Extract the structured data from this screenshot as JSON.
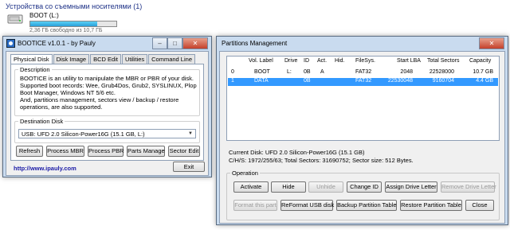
{
  "explorer": {
    "section_title": "Устройства со съемными носителями (1)",
    "drive": {
      "name": "BOOT (L:)",
      "free_text": "2,36 ГБ свободно из 10,7 ГБ",
      "used_fraction": 0.78
    }
  },
  "bootice": {
    "title": "BOOTICE v1.0.1 - by Pauly",
    "title_buttons": {
      "minimize": "–",
      "maximize": "□",
      "close": "✕"
    },
    "tabs": [
      "Physical Disk",
      "Disk Image",
      "BCD Edit",
      "Utilities",
      "Command Line"
    ],
    "description": {
      "label": "Description",
      "lines": [
        "BOOTICE is an utility to manipulate the MBR or PBR of your disk.",
        "Supported boot records: Wee, Grub4Dos, Grub2, SYSLINUX, Plop",
        "Boot Manager, Windows NT 5/6 etc.",
        "And, partitions management, sectors view / backup / restore",
        "operations, are also supported."
      ]
    },
    "destination": {
      "label": "Destination Disk",
      "selected": "USB: UFD 2.0 Silicon-Power16G (15.1 GB, L:)"
    },
    "buttons": {
      "refresh": "Refresh",
      "process_mbr": "Process MBR",
      "process_pbr": "Process PBR",
      "parts_manage": "Parts Manage",
      "sector_edit": "Sector Edit",
      "exit": "Exit"
    },
    "link": "http://www.ipauly.com"
  },
  "partitions": {
    "title": "Partitions Management",
    "columns": [
      "",
      "Vol. Label",
      "Drive",
      "ID",
      "Act.",
      "Hid.",
      "FileSys.",
      "Start LBA",
      "Total Sectors",
      "Capacity"
    ],
    "rows": [
      [
        "0",
        "BOOT",
        "L:",
        "0B",
        "A",
        "",
        "FAT32",
        "2048",
        "22528000",
        "10.7 GB"
      ],
      [
        "1",
        "DATA",
        "",
        "0B",
        "",
        "",
        "FAT32",
        "22530048",
        "9160704",
        "4.4 GB"
      ]
    ],
    "selected_row": 1,
    "current_disk": "Current Disk:  UFD 2.0 Silicon-Power16G (15.1 GB)",
    "chs_info": "C/H/S: 1972/255/63; Total Sectors: 31690752; Sector size: 512 Bytes.",
    "operation_label": "Operation",
    "buttons": {
      "activate": "Activate",
      "hide": "Hide",
      "unhide": "Unhide",
      "change_id": "Change ID",
      "assign_drive_letter": "Assign Drive Letter",
      "remove_drive_letter": "Remove Drive Letter",
      "format_this_part": "Format this part",
      "reformat_usb_disk": "ReFormat USB disk",
      "backup_partition_table": "Backup Partition Table",
      "restore_partition_table": "Restore Partition Table",
      "close": "Close"
    }
  }
}
